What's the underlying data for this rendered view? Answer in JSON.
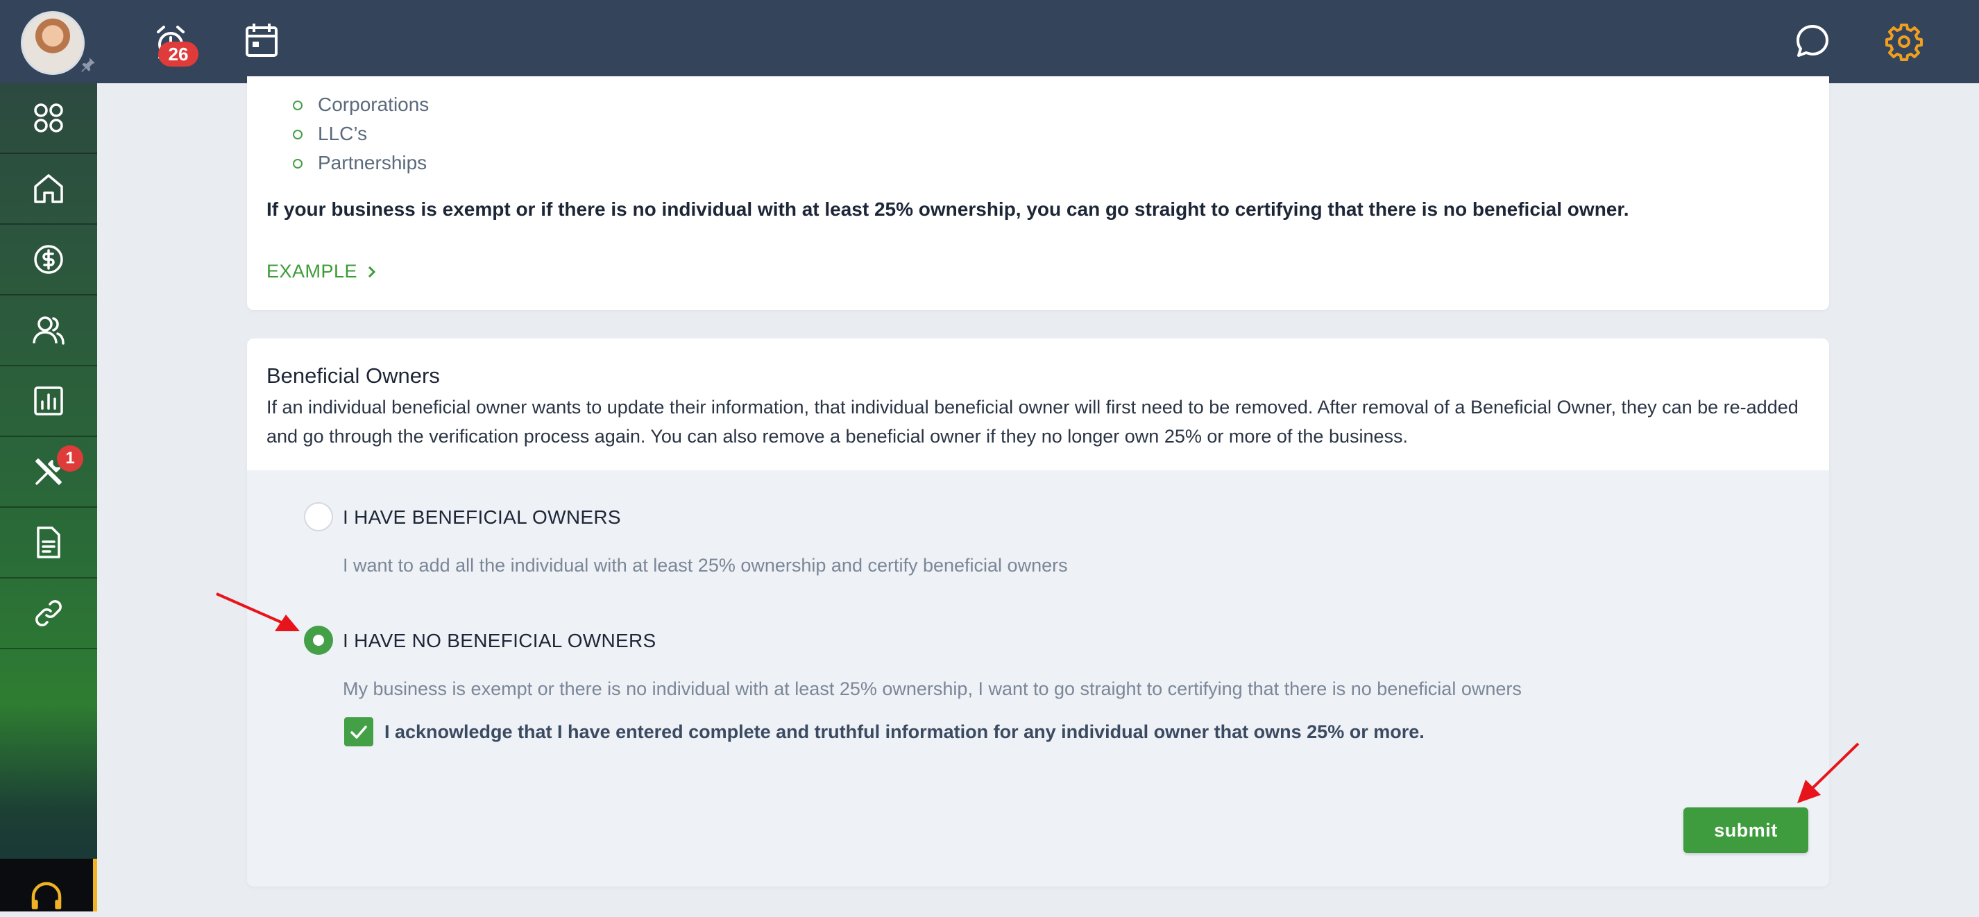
{
  "topbar": {
    "alarm_badge": "26",
    "icons": [
      "avatar",
      "pin-icon",
      "alarm-clock-icon",
      "calendar-icon",
      "chat-icon",
      "gear-icon"
    ]
  },
  "sidebar": {
    "items": [
      {
        "icon": "apps-grid-icon"
      },
      {
        "icon": "home-icon"
      },
      {
        "icon": "dollar-icon"
      },
      {
        "icon": "users-icon"
      },
      {
        "icon": "report-chart-icon"
      },
      {
        "icon": "tools-icon",
        "badge": "1"
      },
      {
        "icon": "document-icon"
      },
      {
        "icon": "link-icon"
      }
    ],
    "support_icon": "headset-icon"
  },
  "exempt_card": {
    "entities": [
      "Corporations",
      "LLC’s",
      "Partnerships"
    ],
    "note": "If your business is exempt or if there is no individual with at least 25% ownership, you can go straight to certifying that there is no beneficial owner.",
    "example_link": "EXAMPLE"
  },
  "owners_card": {
    "title": "Beneficial Owners",
    "description": "If an individual beneficial owner wants to update their information, that individual beneficial owner will first need to be removed. After removal of a Beneficial Owner, they can be re-added and go through the verification process again. You can also remove a beneficial owner if they no longer own 25% or more of the business.",
    "options": [
      {
        "label": "I HAVE BENEFICIAL OWNERS",
        "description": "I want to add all the individual with at least 25% ownership and certify beneficial owners",
        "selected": false
      },
      {
        "label": "I HAVE NO BENEFICIAL OWNERS",
        "description": "My business is exempt or there is no individual with at least 25% ownership, I want to go straight to certifying that there is no beneficial owners",
        "selected": true
      }
    ],
    "acknowledgement": "I acknowledge that I have entered complete and truthful information for any individual owner that owns 25% or more.",
    "acknowledged": true,
    "submit_label": "submit"
  },
  "colors": {
    "topbar": "#34445b",
    "accent_green": "#43a047",
    "badge_red": "#e03b3b",
    "gear_orange": "#f0a020",
    "arrow_red": "#e8141c"
  }
}
